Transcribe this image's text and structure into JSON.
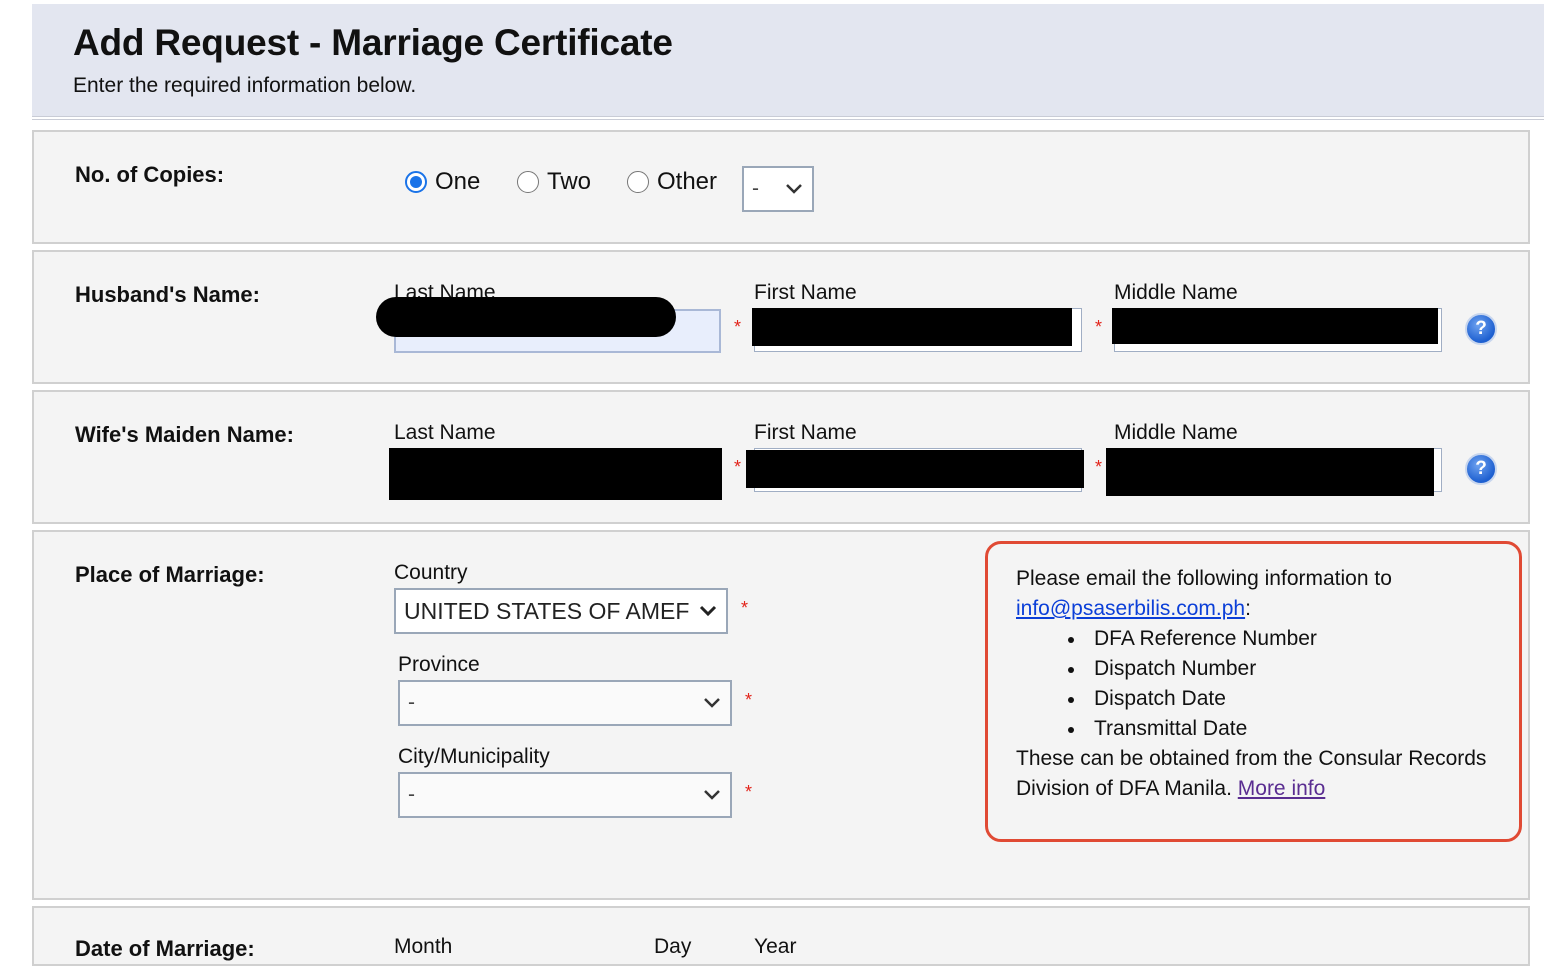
{
  "header": {
    "title": "Add Request - Marriage Certificate",
    "subtitle": "Enter the required information below."
  },
  "copies": {
    "label": "No. of Copies:",
    "options": [
      "One",
      "Two",
      "Other"
    ],
    "selected": "One",
    "other_select_value": "-"
  },
  "husband": {
    "label": "Husband's Name:",
    "last_label": "Last Name",
    "first_label": "First Name",
    "middle_label": "Middle Name"
  },
  "wife": {
    "label": "Wife's Maiden Name:",
    "last_label": "Last Name",
    "first_label": "First Name",
    "middle_label": "Middle Name"
  },
  "place": {
    "label": "Place of Marriage:",
    "country_label": "Country",
    "country_value": "UNITED STATES OF AMEF",
    "province_label": "Province",
    "province_value": "-",
    "city_label": "City/Municipality",
    "city_value": "-"
  },
  "info": {
    "intro": "Please email the following information to",
    "email": "info@psaserbilis.com.ph",
    "colon": ":",
    "items": [
      "DFA Reference Number",
      "Dispatch Number",
      "Dispatch Date",
      "Transmittal Date"
    ],
    "line1": "These can be obtained from the Consular Records",
    "line2": "Division of DFA Manila.",
    "more_link": "More info"
  },
  "date": {
    "label": "Date of Marriage:",
    "month_label": "Month",
    "day_label": "Day",
    "year_label": "Year"
  },
  "required_mark": "*",
  "help_icon_glyph": "?",
  "colors": {
    "accent": "#1a73e8",
    "required": "#e2231a",
    "info_border": "#e04a34",
    "header_bg": "#e3e6f0"
  }
}
